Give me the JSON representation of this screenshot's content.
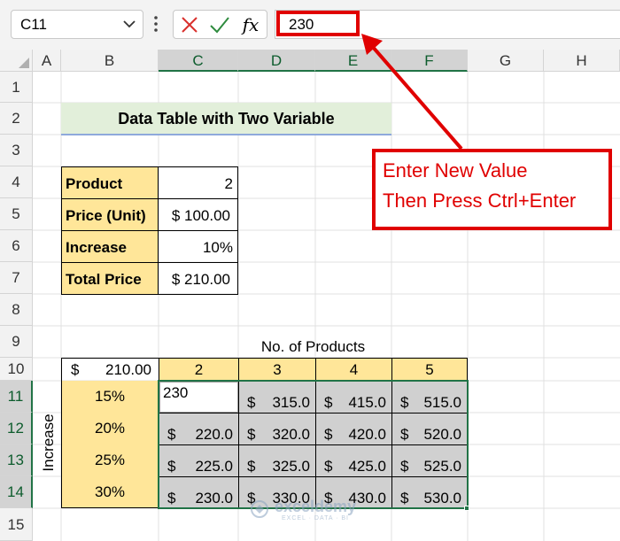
{
  "formula_bar": {
    "name_box": "C11",
    "fx_label": "fx",
    "value": "230"
  },
  "columns": [
    "A",
    "B",
    "C",
    "D",
    "E",
    "F",
    "G",
    "H"
  ],
  "rows": [
    "1",
    "2",
    "3",
    "4",
    "5",
    "6",
    "7",
    "8",
    "9",
    "10",
    "11",
    "12",
    "13",
    "14",
    "15"
  ],
  "title": "Data Table with Two Variable",
  "info_table": [
    {
      "label": "Product",
      "value": "2"
    },
    {
      "label": "Price (Unit)",
      "value": "$ 100.00"
    },
    {
      "label": "Increase",
      "value": "10%"
    },
    {
      "label": "Total Price",
      "value": "$ 210.00"
    }
  ],
  "data_table": {
    "col_header_title": "No. of Products",
    "row_header_title": "Increase",
    "corner_currency": "$",
    "corner_value": "210.00",
    "col_values": [
      "2",
      "3",
      "4",
      "5"
    ],
    "row_values": [
      "15%",
      "20%",
      "25%",
      "30%"
    ],
    "cells": [
      [
        "230",
        "315.0",
        "415.0",
        "515.0"
      ],
      [
        "220.0",
        "320.0",
        "420.0",
        "520.0"
      ],
      [
        "225.0",
        "325.0",
        "425.0",
        "525.0"
      ],
      [
        "230.0",
        "330.0",
        "430.0",
        "530.0"
      ]
    ],
    "currency": "$"
  },
  "callout": {
    "line1": "Enter New Value",
    "line2": "Then Press Ctrl+Enter"
  },
  "watermark": {
    "brand": "exceldemy",
    "tagline": "EXCEL · DATA · BI"
  },
  "colors": {
    "accent_red": "#e00000",
    "excel_green": "#217346",
    "header_yellow": "#ffe699",
    "title_green": "#e2efda"
  }
}
